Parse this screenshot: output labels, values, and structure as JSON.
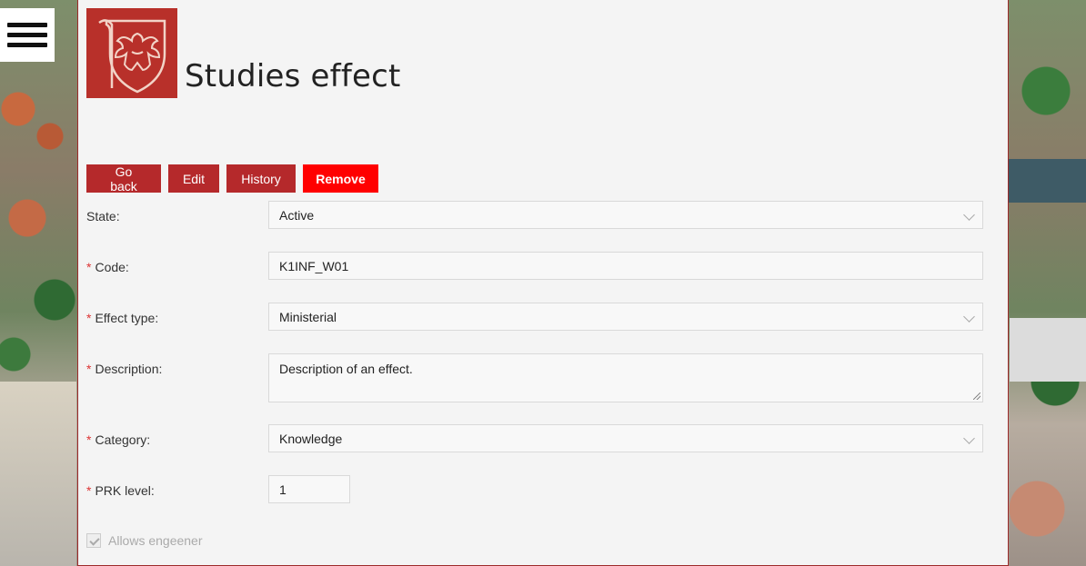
{
  "page": {
    "title": "Studies effect"
  },
  "actions": {
    "go_back": "Go back",
    "edit": "Edit",
    "history": "History",
    "remove": "Remove"
  },
  "form": {
    "state": {
      "label": "State",
      "value": "Active"
    },
    "code": {
      "label": "Code",
      "value": "K1INF_W01"
    },
    "effect_type": {
      "label": "Effect type",
      "value": "Ministerial"
    },
    "description": {
      "label": "Description",
      "value": "Description of an effect."
    },
    "category": {
      "label": "Category",
      "value": "Knowledge"
    },
    "prk_level": {
      "label": "PRK level",
      "value": "1"
    },
    "allows_engineer": {
      "label": "Allows engeener",
      "checked": true
    }
  },
  "colors": {
    "brand": "#b8302a",
    "danger": "#ff0000",
    "panel": "#f4f4f4"
  },
  "icons": {
    "menu": "hamburger-icon",
    "logo": "eagle-crest-icon",
    "dropdown": "chevron-down-icon"
  }
}
